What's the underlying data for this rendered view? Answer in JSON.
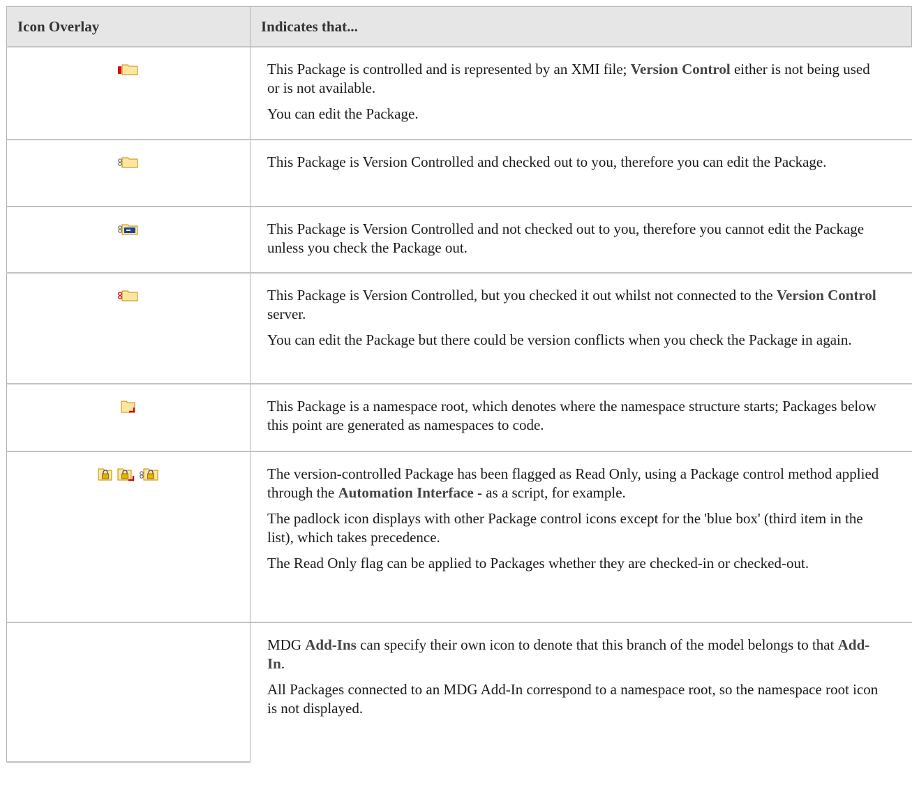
{
  "header": {
    "col1": "Icon Overlay",
    "col2": "Indicates that..."
  },
  "rows": [
    {
      "icons": [
        "controlled-package-icon"
      ],
      "p1": [
        "This Package is controlled and is represented by an XMI file; ",
        "Version Control",
        " either is not being used or is not available."
      ],
      "p2": "You can edit the Package."
    },
    {
      "icons": [
        "checked-out-package-icon"
      ],
      "p1": "This Package is Version Controlled and checked out to you, therefore you can edit the Package."
    },
    {
      "icons": [
        "checked-in-package-icon"
      ],
      "p1": "This Package is Version Controlled and not checked out to you, therefore you cannot edit the Package unless you check the Package out."
    },
    {
      "icons": [
        "offline-checked-out-package-icon"
      ],
      "p1": [
        "This Package is Version Controlled, but you checked it out whilst not connected to the ",
        "Version Control",
        " server."
      ],
      "p2": "You can edit the Package but there could be version conflicts when you check the Package in again."
    },
    {
      "icons": [
        "namespace-root-icon"
      ],
      "p1": "This Package is a namespace root, which denotes where the namespace structure starts; Packages below this point are generated as namespaces to code."
    },
    {
      "icons": [
        "read-only-package-icon",
        "read-only-namespace-package-icon",
        "read-only-version-controlled-package-icon"
      ],
      "p1": [
        "The version-controlled Package has been flagged as Read Only, using a Package control method applied through the ",
        "Automation Interface",
        " - as a script, for example."
      ],
      "p2": "The padlock icon displays with other Package control icons except for the 'blue box' (third item in the list), which takes precedence.",
      "p3": "The Read Only flag can be applied to Packages whether they are checked-in or checked-out."
    },
    {
      "icons": [],
      "p1": [
        "MDG ",
        "Add-Ins",
        " can specify their own icon to denote that this branch of the model belongs to that ",
        "Add-In",
        "."
      ],
      "p2": "All Packages connected to an MDG Add-In correspond to a namespace root, so the namespace root icon is not displayed."
    }
  ]
}
